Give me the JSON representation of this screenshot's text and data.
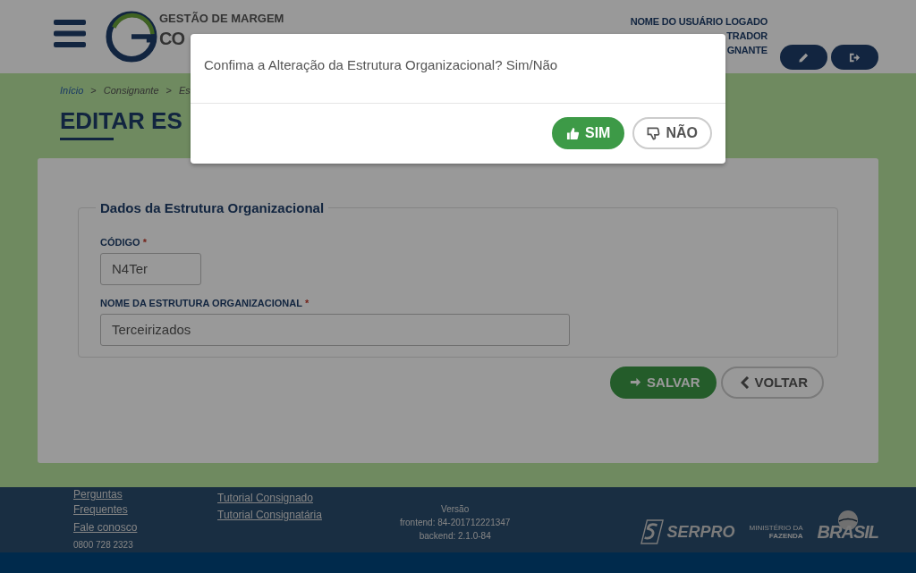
{
  "header": {
    "logo_lines": [
      "GESTÃO DE MARGEM",
      "CO"
    ],
    "user_lines": [
      "NOME DO USUÁRIO LOGADO",
      "TRADOR",
      "GNANTE"
    ]
  },
  "breadcrumb": {
    "separator": ">",
    "items": [
      {
        "label": "Início",
        "link": true
      },
      {
        "label": "Consignante",
        "link": false
      },
      {
        "label": "Es",
        "link": false
      }
    ]
  },
  "page_title": "EDITAR ES",
  "form": {
    "legend": "Dados da Estrutura Organizacional",
    "required_mark": "*",
    "fields": [
      {
        "label": "CÓDIGO",
        "required": true,
        "value": "N4Ter",
        "kind": "short"
      },
      {
        "label": "NOME DA ESTRUTURA ORGANIZACIONAL",
        "required": true,
        "value": "Terceirizados",
        "kind": "long"
      }
    ],
    "buttons": [
      {
        "label": "SALVAR",
        "kind": "primary"
      },
      {
        "label": "VOLTAR",
        "kind": "secondary"
      }
    ]
  },
  "footer": {
    "links_col1": [
      "Perguntas Frequentes",
      "Fale conosco"
    ],
    "phone": "0800 728 2323",
    "links_col2": [
      "Tutorial Consignado",
      "Tutorial Consignatária"
    ],
    "version": [
      "Versão",
      "frontend: 84-201712221347",
      "backend: 2.1.0-84"
    ],
    "serpro": "SERPRO",
    "ministry": [
      "MINISTÉRIO DA",
      "FAZENDA"
    ],
    "brasil": "BRASIL"
  },
  "dialog": {
    "message": "Confima a Alteração da Estrutura Organizacional? Sim/Não",
    "buttons": [
      {
        "label": "SIM",
        "kind": "primary"
      },
      {
        "label": "NÃO",
        "kind": "secondary"
      }
    ]
  }
}
